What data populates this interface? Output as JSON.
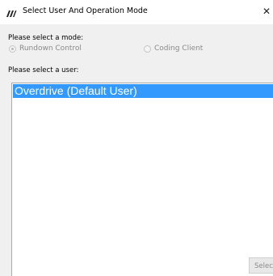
{
  "window": {
    "title": "Select User And Operation Mode",
    "close_glyph": "✕"
  },
  "mode": {
    "label": "Please select a mode:",
    "options": [
      {
        "label": "Rundown Control",
        "checked": true,
        "enabled": false
      },
      {
        "label": "Coding Client",
        "checked": false,
        "enabled": false
      }
    ]
  },
  "user": {
    "label": "Please select a user:",
    "items": [
      {
        "label": "Overdrive (Default User)",
        "selected": true
      }
    ]
  },
  "footer": {
    "select_label": "Select"
  },
  "colors": {
    "selection": "#3399ff",
    "dialog_background": "#f0f0f0",
    "disabled_text": "#8a8a8a"
  },
  "icons": {
    "app": "app-logo-icon",
    "close": "close-icon"
  }
}
